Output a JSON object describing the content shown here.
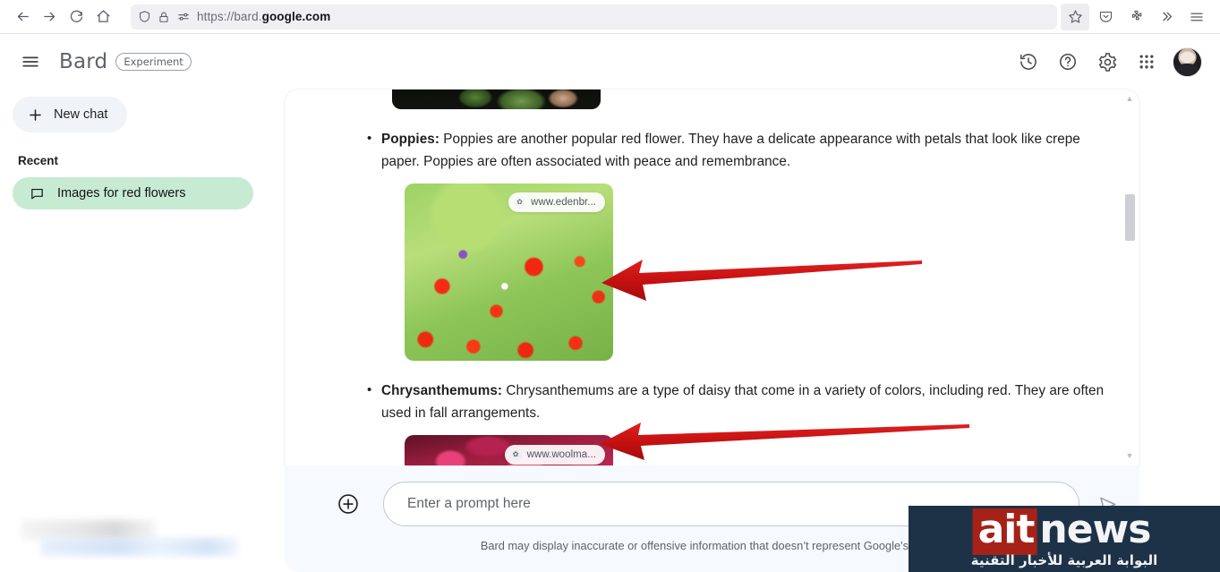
{
  "browser": {
    "back_icon": "back-arrow-icon",
    "forward_icon": "forward-arrow-icon",
    "reload_icon": "reload-icon",
    "home_icon": "home-icon",
    "shield_icon": "shield-icon",
    "lock_icon": "lock-icon",
    "permissions_icon": "page-permissions-icon",
    "url_prefix": "https://bard.",
    "url_domain": "google.com",
    "bookmark_icon": "star-icon",
    "pocket_icon": "pocket-save-icon",
    "extensions_icon": "extensions-puzzle-icon",
    "overflow_icon": "double-chevron-icon",
    "appmenu_icon": "hamburger-menu-icon"
  },
  "header": {
    "menu_icon": "hamburger-menu-icon",
    "title": "Bard",
    "badge": "Experiment",
    "history_icon": "history-clock-icon",
    "help_icon": "question-mark-help-icon",
    "settings_icon": "gear-icon",
    "apps_icon": "apps-grid-icon",
    "avatar_icon": "user-avatar"
  },
  "sidebar": {
    "new_chat_label": "New chat",
    "new_chat_icon": "plus-icon",
    "recent_label": "Recent",
    "recent_items": [
      {
        "label": "Images for red flowers",
        "icon": "chat-bubble-icon"
      }
    ]
  },
  "conversation": {
    "items": [
      {
        "term": "Poppies:",
        "text": " Poppies are another popular red flower. They have a delicate appearance with petals that look like crepe paper. Poppies are often associated with peace and remembrance.",
        "image_alt": "red-poppy-field-photo",
        "attribution": "www.edenbr...",
        "attribution_icon": "site-favicon"
      },
      {
        "term": "Chrysanthemums:",
        "text": " Chrysanthemums are a type of daisy that come in a variety of colors, including red. They are often used in fall arrangements.",
        "image_alt": "red-chrysanthemum-photo",
        "attribution": "www.woolma...",
        "attribution_icon": "site-favicon"
      }
    ],
    "scrollbar": {
      "up_arrow": "▲",
      "down_arrow": "▼"
    },
    "annotations": [
      {
        "name": "red-arrow-poppies",
        "direction": "left",
        "color": "#cc1414"
      },
      {
        "name": "red-arrow-chrysanthemums",
        "direction": "left",
        "color": "#cc1414"
      }
    ]
  },
  "composer": {
    "add_icon": "plus-circle-icon",
    "placeholder": "Enter a prompt here",
    "value": "",
    "send_icon": "send-paper-plane-icon",
    "disclaimer": "Bard may display inaccurate or offensive information that doesn’t represent Google’s views."
  },
  "watermark": {
    "logo_red": "ait",
    "logo_white": "news",
    "tagline": "البوابة العربية للأخبار التقنية"
  },
  "colors": {
    "accent_green": "#c7ead3",
    "panel_bg": "#f6f9fe",
    "arrow_red": "#cc1414",
    "watermark_navy": "#1d3247",
    "watermark_red": "#a62118"
  }
}
